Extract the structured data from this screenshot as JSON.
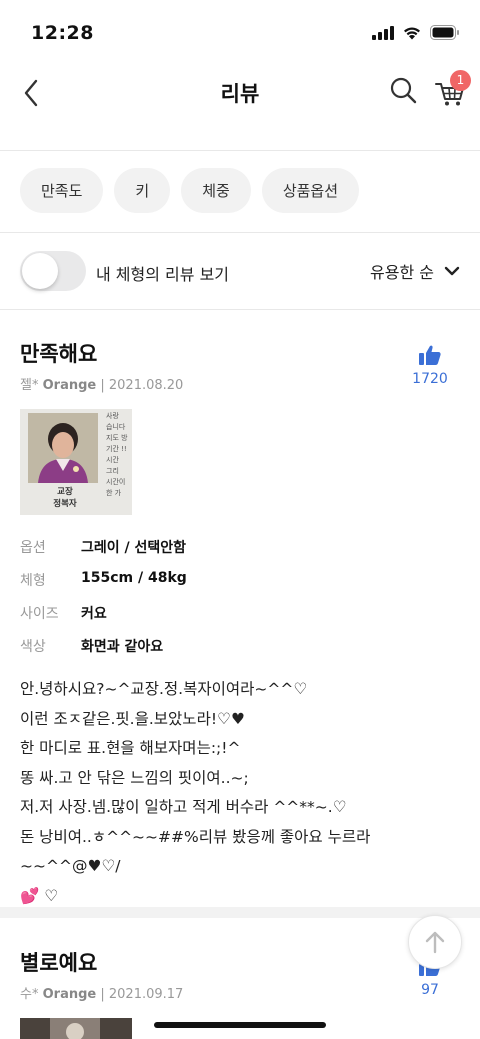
{
  "status_bar": {
    "time": "12:28"
  },
  "header": {
    "title": "리뷰",
    "cart_count": "1"
  },
  "filters": [
    "만족도",
    "키",
    "체중",
    "상품옵션"
  ],
  "toggle": {
    "label": "내 체형의 리뷰 보기",
    "on": false
  },
  "sort": {
    "label": "유용한 순"
  },
  "reviews": [
    {
      "title": "만족해요",
      "author": "젤*",
      "brand": "Orange",
      "date": "2021.08.20",
      "likes": "1720",
      "photo": {
        "caption_line1": "교장",
        "caption_line2": "정복자",
        "side_text": "사랑\n습니다\n지도 방\n기간 !!\n시간 \n그리\n시간이\n한 가"
      },
      "specs": [
        {
          "key": "옵션",
          "value": "그레이 / 선택안함"
        },
        {
          "key": "체형",
          "value": "155cm / 48kg"
        },
        {
          "key": "사이즈",
          "value": "커요"
        },
        {
          "key": "색상",
          "value": "화면과 같아요"
        }
      ],
      "body": "안.녕하시요?~^교장.정.복자이여라~^^♡\n이런 조ㅈ같은.핏.을.보았노라!♡♥\n한 마디로 표.현을 해보자며는:;!^\n똥 싸.고 안 닦은 느낌의 핏이여..~;\n저.저 사장.넴.많이 일하고 적게 버수라 ^^**~.♡\n돈 낭비여..ㅎ^^~~##%리뷰 봤응께 좋아요 누르라~~^^@♥♡/\n💕 ♡"
    },
    {
      "title": "별로예요",
      "author": "수*",
      "brand": "Orange",
      "date": "2021.09.17",
      "likes": "97"
    }
  ]
}
